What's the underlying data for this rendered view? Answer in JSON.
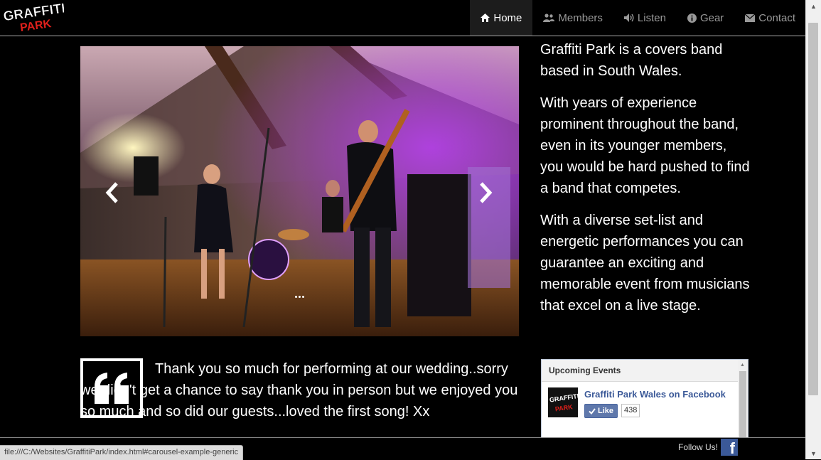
{
  "nav": {
    "items": [
      {
        "label": "Home",
        "icon": "home-icon",
        "active": true
      },
      {
        "label": "Members",
        "icon": "users-icon",
        "active": false
      },
      {
        "label": "Listen",
        "icon": "volume-icon",
        "active": false
      },
      {
        "label": "Gear",
        "icon": "info-circle-icon",
        "active": false
      },
      {
        "label": "Contact",
        "icon": "envelope-icon",
        "active": false
      }
    ]
  },
  "intro": {
    "p1": "Graffiti Park is a covers band based in South Wales.",
    "p2": "With years of experience prominent throughout the band, even in its younger members, you would be hard pushed to find a band that competes.",
    "p3": "With a diverse set-list and energetic performances you can guarantee an exciting and memorable event from musicians that excel on a live stage."
  },
  "quote": {
    "text": "Thank you so much for performing at our wedding..sorry we didn't get a chance to say thank you in person but we enjoyed you so much and so did our guests...loved the first song! Xx"
  },
  "events": {
    "title": "Upcoming Events",
    "page_name": "Graffiti Park Wales on Facebook",
    "like_label": "Like",
    "like_count": "438"
  },
  "footer": {
    "follow_label": "Follow Us!",
    "status_url": "file:///C:/Websites/GraffitiPark/index.html#carousel-example-generic"
  },
  "colors": {
    "background": "#000000",
    "facebook": "#3b5998",
    "nav_active_bg": "#1c1c1c"
  }
}
